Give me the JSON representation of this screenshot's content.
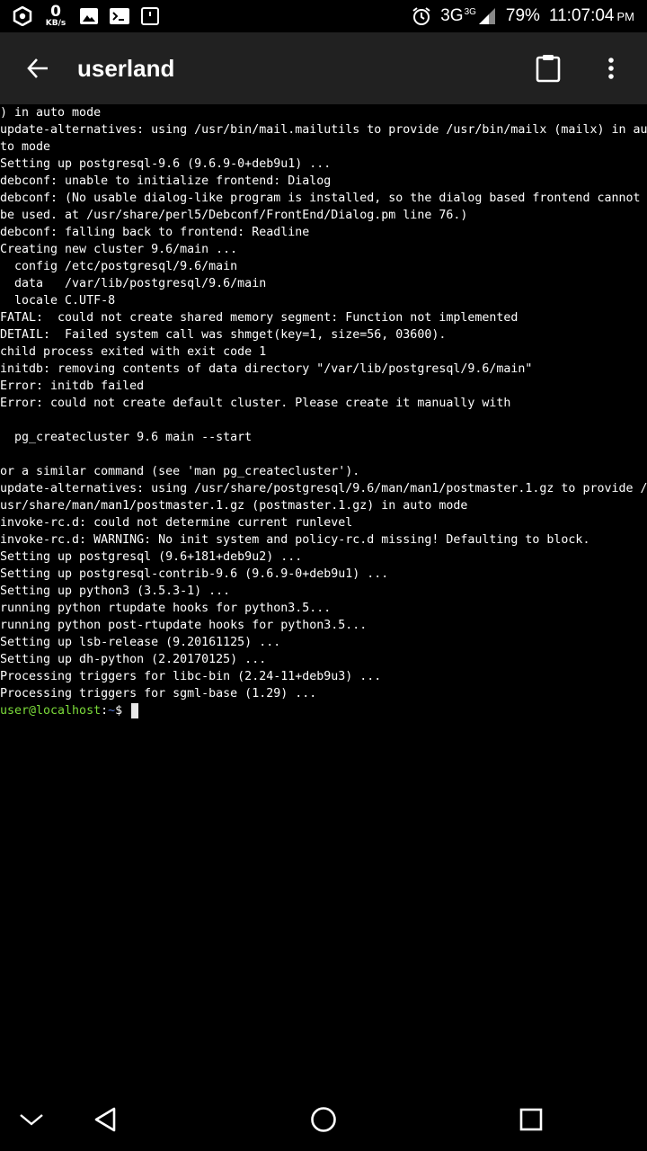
{
  "status_bar": {
    "kbs_value": "0",
    "kbs_unit": "KB/s",
    "network": "3G",
    "network_sup": "3G",
    "battery": "79%",
    "time": "11:07:04",
    "ampm": "PM",
    "icons": [
      "hexagon-icon",
      "image-icon",
      "terminal-icon",
      "sd-card-icon",
      "alarm-icon",
      "signal-icon"
    ]
  },
  "app_bar": {
    "title": "userland",
    "icons": [
      "back-arrow-icon",
      "clipboard-icon",
      "more-vert-icon"
    ]
  },
  "terminal": {
    "lines": [
      ") in auto mode",
      "update-alternatives: using /usr/bin/mail.mailutils to provide /usr/bin/mailx (mailx) in au",
      "to mode",
      "Setting up postgresql-9.6 (9.6.9-0+deb9u1) ...",
      "debconf: unable to initialize frontend: Dialog",
      "debconf: (No usable dialog-like program is installed, so the dialog based frontend cannot",
      "be used. at /usr/share/perl5/Debconf/FrontEnd/Dialog.pm line 76.)",
      "debconf: falling back to frontend: Readline",
      "Creating new cluster 9.6/main ...",
      "  config /etc/postgresql/9.6/main",
      "  data   /var/lib/postgresql/9.6/main",
      "  locale C.UTF-8",
      "FATAL:  could not create shared memory segment: Function not implemented",
      "DETAIL:  Failed system call was shmget(key=1, size=56, 03600).",
      "child process exited with exit code 1",
      "initdb: removing contents of data directory \"/var/lib/postgresql/9.6/main\"",
      "Error: initdb failed",
      "Error: could not create default cluster. Please create it manually with",
      "",
      "  pg_createcluster 9.6 main --start",
      "",
      "or a similar command (see 'man pg_createcluster').",
      "update-alternatives: using /usr/share/postgresql/9.6/man/man1/postmaster.1.gz to provide /",
      "usr/share/man/man1/postmaster.1.gz (postmaster.1.gz) in auto mode",
      "invoke-rc.d: could not determine current runlevel",
      "invoke-rc.d: WARNING: No init system and policy-rc.d missing! Defaulting to block.",
      "Setting up postgresql (9.6+181+deb9u2) ...",
      "Setting up postgresql-contrib-9.6 (9.6.9-0+deb9u1) ...",
      "Setting up python3 (3.5.3-1) ...",
      "running python rtupdate hooks for python3.5...",
      "running python post-rtupdate hooks for python3.5...",
      "Setting up lsb-release (9.20161125) ...",
      "Setting up dh-python (2.20170125) ...",
      "Processing triggers for libc-bin (2.24-11+deb9u3) ...",
      "Processing triggers for sgml-base (1.29) ..."
    ],
    "prompt": {
      "user_host": "user@localhost",
      "separator": ":",
      "path": "~",
      "symbol": "$ "
    },
    "colors": {
      "prompt_user": "#7cdc3a",
      "prompt_path": "#5a7bd8",
      "cursor": "#e8e8e8"
    }
  },
  "nav_bar": {
    "icons": [
      "keyboard-hide-icon",
      "back-triangle-icon",
      "home-circle-icon",
      "recents-square-icon"
    ]
  }
}
